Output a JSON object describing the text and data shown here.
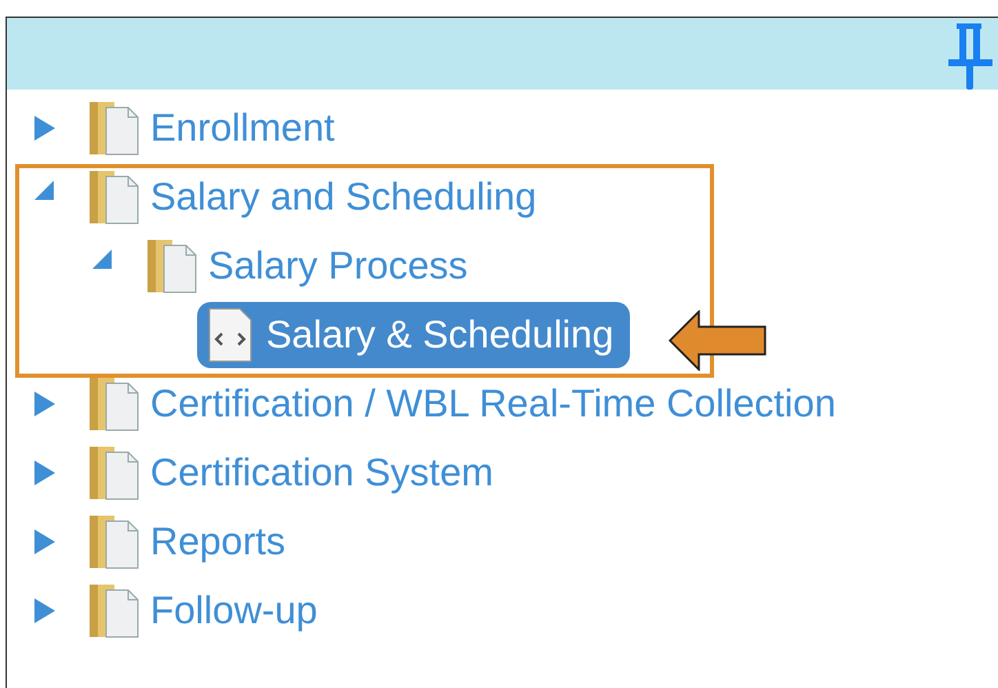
{
  "tree": [
    {
      "label": "Enrollment",
      "kind": "folder",
      "expanded": false,
      "selected": false
    },
    {
      "label": "Salary and Scheduling",
      "kind": "folder",
      "expanded": true,
      "selected": false,
      "children": [
        {
          "label": "Salary Process",
          "kind": "folder",
          "expanded": true,
          "selected": false,
          "children": [
            {
              "label": "Salary & Scheduling",
              "kind": "document",
              "selected": true
            }
          ]
        }
      ]
    },
    {
      "label": "Certification / WBL Real-Time Collection",
      "kind": "folder",
      "expanded": false,
      "selected": false
    },
    {
      "label": "Certification System",
      "kind": "folder",
      "expanded": false,
      "selected": false
    },
    {
      "label": "Reports",
      "kind": "folder",
      "expanded": false,
      "selected": false
    },
    {
      "label": "Follow-up",
      "kind": "folder",
      "expanded": false,
      "selected": false
    }
  ]
}
